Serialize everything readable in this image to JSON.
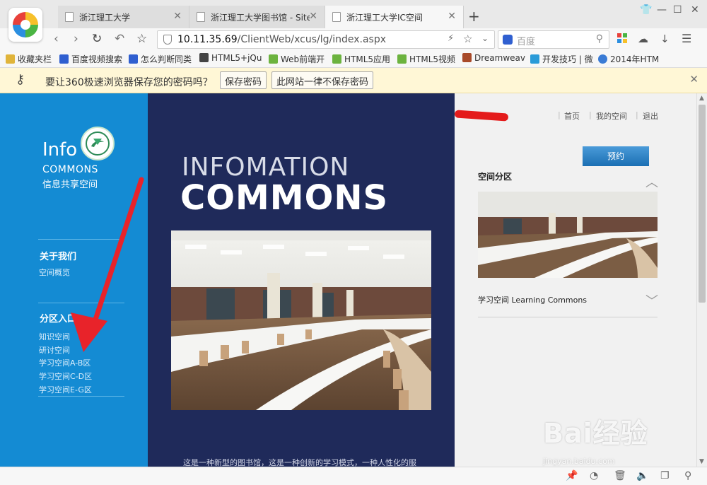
{
  "browser": {
    "tabs": [
      {
        "title": "浙江理工大学",
        "active": false
      },
      {
        "title": "浙江理工大学图书馆 - Site",
        "active": false
      },
      {
        "title": "浙江理工大学IC空间",
        "active": true
      }
    ],
    "new_tab": "+",
    "url": {
      "host": "10.11.35.69",
      "path": "/ClientWeb/xcus/lg/index.aspx"
    },
    "search_placeholder": "百度",
    "bookmarks": [
      {
        "label": "收藏夹栏",
        "icon": "folder-icon",
        "color": "#e0b43a"
      },
      {
        "label": "百度视频搜索",
        "icon": "baidu-paw-icon",
        "color": "#2f5fd0"
      },
      {
        "label": "怎么判断同类",
        "icon": "baidu-paw-icon",
        "color": "#2f5fd0"
      },
      {
        "label": "HTML5+jQu",
        "icon": "site-51-icon",
        "color": "#444444"
      },
      {
        "label": "Web前端开",
        "icon": "green-square-icon",
        "color": "#6cb33f"
      },
      {
        "label": "HTML5应用",
        "icon": "green-square-icon",
        "color": "#6cb33f"
      },
      {
        "label": "HTML5视频",
        "icon": "green-square-icon",
        "color": "#6cb33f"
      },
      {
        "label": "Dreamweav",
        "icon": "dreamweaver-icon",
        "color": "#a84a2a"
      },
      {
        "label": "开发技巧 | 微",
        "icon": "v-icon",
        "color": "#2a9bd8"
      },
      {
        "label": "2014年HTM",
        "icon": "globe-icon",
        "color": "#3a7bd5"
      }
    ],
    "password_prompt": {
      "message": "要让360极速浏览器保存您的密码吗？",
      "save": "保存密码",
      "never": "此网站一律不保存密码"
    }
  },
  "page": {
    "left": {
      "brand_info": "Info",
      "brand_commons": "COMMONS",
      "brand_sub": "信息共享空间",
      "about_heading": "关于我们",
      "about_links": [
        "空间概览"
      ],
      "zones_heading": "分区入口",
      "zone_links": [
        "知识空间",
        "研讨空间",
        "学习空间A-B区",
        "学习空间C-D区",
        "学习空间E-G区"
      ]
    },
    "middle": {
      "title_line1": "INFOMATION",
      "title_line2": "COMMONS",
      "intro_text": "这是一种新型的图书馆，这是一种创新的学习模式，一种人性化的服"
    },
    "right": {
      "nav": [
        "首页",
        "我的空间",
        "退出"
      ],
      "book_button": "预约",
      "section_title": "空间分区",
      "learning_commons": "学习空间  Learning Commons"
    }
  },
  "watermark": {
    "text": "Bai经验",
    "url": "jingyan.baidu.com"
  },
  "colors": {
    "left_panel": "#148bd3",
    "middle_panel": "#1f2a5a",
    "password_bar": "#fff7d6",
    "annotation_arrow": "#e8232a"
  }
}
